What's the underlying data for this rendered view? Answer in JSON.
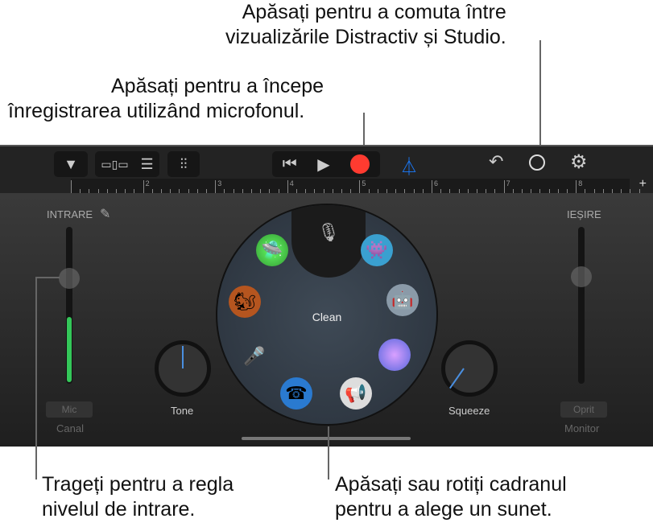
{
  "callouts": {
    "toggle_view": [
      "Apăsați pentru a comuta între",
      "vizualizările Distractiv și Studio."
    ],
    "record": [
      "Apăsați pentru a începe",
      "înregistrarea utilizând microfonul."
    ],
    "input_level": [
      "Trageți pentru a regla",
      "nivelul de intrare."
    ],
    "dial": [
      "Apăsați sau rotiți cadranul",
      "pentru a alege un sunet."
    ]
  },
  "toolbar": {
    "record_color": "#ff3b30",
    "metronome_color": "#1a7cff"
  },
  "ruler": {
    "bars": [
      "2",
      "3",
      "4",
      "5",
      "6",
      "7",
      "8"
    ],
    "add": "+"
  },
  "input": {
    "label": "INTRARE",
    "level": 0.27,
    "channel_button": "Mic",
    "channel_label": "Canal"
  },
  "output": {
    "label": "IEȘIRE",
    "monitor_button": "Oprit",
    "monitor_label": "Monitor"
  },
  "knobs": {
    "tone": "Tone",
    "squeeze": "Squeeze"
  },
  "dial": {
    "selected": "Clean",
    "sounds": [
      "microphone",
      "monster",
      "robot",
      "bubbles",
      "megaphone",
      "telephone",
      "microphone-gold",
      "chipmunk",
      "ufo"
    ]
  },
  "meter_color": "#34c759"
}
